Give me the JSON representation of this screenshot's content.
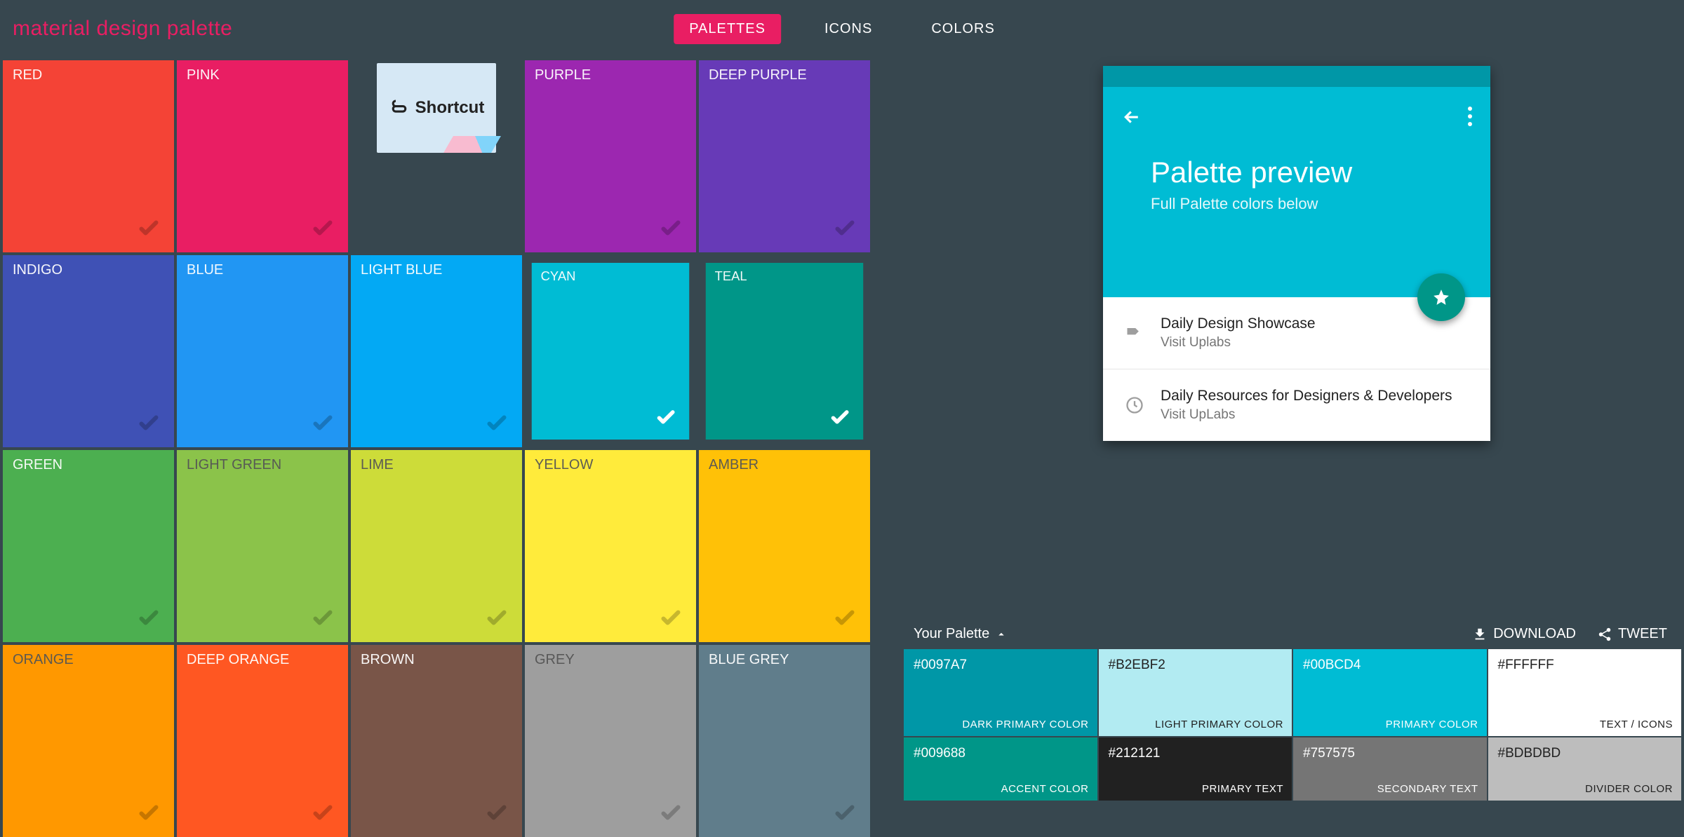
{
  "brand": {
    "part1": "material design",
    "part2": "palette"
  },
  "nav": {
    "items": [
      "PALETTES",
      "ICONS",
      "COLORS"
    ],
    "active": 0
  },
  "ad": {
    "label": "Shortcut"
  },
  "swatches": [
    {
      "name": "RED",
      "bg": "#f44336",
      "text": "#fff",
      "selected": false
    },
    {
      "name": "PINK",
      "bg": "#e91e63",
      "text": "#fff",
      "selected": false
    },
    {
      "name": "AD"
    },
    {
      "name": "PURPLE",
      "bg": "#9c27b0",
      "text": "#fff",
      "selected": false
    },
    {
      "name": "DEEP PURPLE",
      "bg": "#673ab7",
      "text": "#fff",
      "selected": false
    },
    {
      "name": "INDIGO",
      "bg": "#3f51b5",
      "text": "#fff",
      "selected": false
    },
    {
      "name": "BLUE",
      "bg": "#2196f3",
      "text": "#fff",
      "selected": false
    },
    {
      "name": "LIGHT BLUE",
      "bg": "#03a9f4",
      "text": "#fff",
      "selected": false
    },
    {
      "name": "CYAN",
      "bg": "#00bcd4",
      "text": "#fff",
      "selected": true
    },
    {
      "name": "TEAL",
      "bg": "#009688",
      "text": "#fff",
      "selected": true
    },
    {
      "name": "GREEN",
      "bg": "#4caf50",
      "text": "#fff",
      "selected": false
    },
    {
      "name": "LIGHT GREEN",
      "bg": "#8bc34a",
      "text": "#555",
      "selected": false
    },
    {
      "name": "LIME",
      "bg": "#cddc39",
      "text": "#555",
      "selected": false
    },
    {
      "name": "YELLOW",
      "bg": "#ffeb3b",
      "text": "#555",
      "selected": false
    },
    {
      "name": "AMBER",
      "bg": "#ffc107",
      "text": "#555",
      "selected": false
    },
    {
      "name": "ORANGE",
      "bg": "#ff9800",
      "text": "#555",
      "selected": false
    },
    {
      "name": "DEEP ORANGE",
      "bg": "#ff5722",
      "text": "#fff",
      "selected": false
    },
    {
      "name": "BROWN",
      "bg": "#795548",
      "text": "#fff",
      "selected": false
    },
    {
      "name": "GREY",
      "bg": "#9e9e9e",
      "text": "#555",
      "selected": false
    },
    {
      "name": "BLUE GREY",
      "bg": "#607d8b",
      "text": "#fff",
      "selected": false
    }
  ],
  "preview": {
    "dark_bar": "#0097a7",
    "main_bar": "#00bcd4",
    "title": "Palette preview",
    "subtitle": "Full Palette colors below",
    "fab_bg": "#009688",
    "rows": [
      {
        "icon": "label",
        "title": "Daily Design Showcase",
        "sub": "Visit Uplabs"
      },
      {
        "icon": "clock",
        "title": "Daily Resources for Designers & Developers",
        "sub": "Visit UpLabs"
      }
    ]
  },
  "panel": {
    "title": "Your Palette",
    "download": "DOWNLOAD",
    "tweet": "TWEET",
    "cells": [
      {
        "hex": "#0097A7",
        "lbl": "DARK PRIMARY COLOR",
        "bg": "#0097a7",
        "fg": "#fff"
      },
      {
        "hex": "#B2EBF2",
        "lbl": "LIGHT PRIMARY COLOR",
        "bg": "#b2ebf2",
        "fg": "#212121"
      },
      {
        "hex": "#00BCD4",
        "lbl": "PRIMARY COLOR",
        "bg": "#00bcd4",
        "fg": "#fff"
      },
      {
        "hex": "#FFFFFF",
        "lbl": "TEXT / ICONS",
        "bg": "#ffffff",
        "fg": "#212121"
      },
      {
        "hex": "#009688",
        "lbl": "ACCENT COLOR",
        "bg": "#009688",
        "fg": "#fff"
      },
      {
        "hex": "#212121",
        "lbl": "PRIMARY TEXT",
        "bg": "#212121",
        "fg": "#fff"
      },
      {
        "hex": "#757575",
        "lbl": "SECONDARY TEXT",
        "bg": "#757575",
        "fg": "#fff"
      },
      {
        "hex": "#BDBDBD",
        "lbl": "DIVIDER COLOR",
        "bg": "#bdbdbd",
        "fg": "#212121"
      }
    ]
  }
}
